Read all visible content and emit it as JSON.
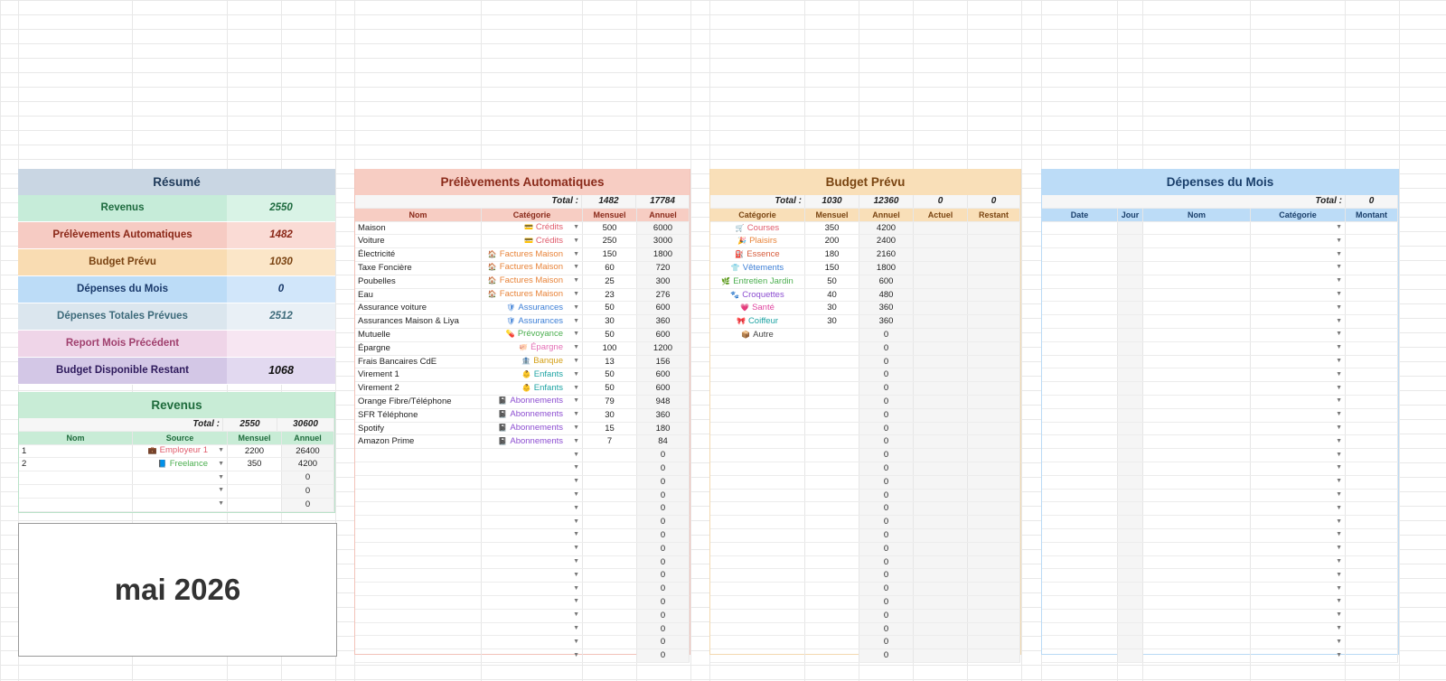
{
  "summary": {
    "title": "Résumé",
    "rows": [
      {
        "label": "Revenus",
        "value": "2550"
      },
      {
        "label": "Prélèvements Automatiques",
        "value": "1482"
      },
      {
        "label": "Budget Prévu",
        "value": "1030"
      },
      {
        "label": "Dépenses du Mois",
        "value": "0"
      },
      {
        "label": "Dépenses Totales Prévues",
        "value": "2512"
      },
      {
        "label": "Report Mois Précédent",
        "value": ""
      },
      {
        "label": "Budget Disponible Restant",
        "value": "1068"
      }
    ]
  },
  "revenus": {
    "title": "Revenus",
    "total_label": "Total :",
    "total_mensuel": "2550",
    "total_annuel": "30600",
    "headers": [
      "Nom",
      "Source",
      "Mensuel",
      "Annuel"
    ],
    "rows": [
      {
        "nom": "1",
        "source": "Employeur 1",
        "icon": "briefcase-icon",
        "mensuel": "2200",
        "annuel": "26400"
      },
      {
        "nom": "2",
        "source": "Freelance",
        "icon": "book-icon",
        "mensuel": "350",
        "annuel": "4200"
      },
      {
        "nom": "",
        "source": "",
        "icon": "",
        "mensuel": "",
        "annuel": "0"
      },
      {
        "nom": "",
        "source": "",
        "icon": "",
        "mensuel": "",
        "annuel": "0"
      },
      {
        "nom": "",
        "source": "",
        "icon": "",
        "mensuel": "",
        "annuel": "0"
      }
    ]
  },
  "month_label": "mai 2026",
  "prelevements": {
    "title": "Prélèvements Automatiques",
    "total_label": "Total :",
    "total_mensuel": "1482",
    "total_annuel": "17784",
    "headers": [
      "Nom",
      "Catégorie",
      "Mensuel",
      "Annuel"
    ],
    "rows": [
      {
        "nom": "Maison",
        "cat": "Crédits",
        "icon": "credit-card-icon",
        "mensuel": "500",
        "annuel": "6000"
      },
      {
        "nom": "Voiture",
        "cat": "Crédits",
        "icon": "credit-card-icon",
        "mensuel": "250",
        "annuel": "3000"
      },
      {
        "nom": "Électricité",
        "cat": "Factures Maison",
        "icon": "house-icon",
        "mensuel": "150",
        "annuel": "1800"
      },
      {
        "nom": "Taxe Foncière",
        "cat": "Factures Maison",
        "icon": "house-icon",
        "mensuel": "60",
        "annuel": "720"
      },
      {
        "nom": "Poubelles",
        "cat": "Factures Maison",
        "icon": "house-icon",
        "mensuel": "25",
        "annuel": "300"
      },
      {
        "nom": "Eau",
        "cat": "Factures Maison",
        "icon": "house-icon",
        "mensuel": "23",
        "annuel": "276"
      },
      {
        "nom": "Assurance voiture",
        "cat": "Assurances",
        "icon": "shield-icon",
        "mensuel": "50",
        "annuel": "600"
      },
      {
        "nom": "Assurances Maison & Liya",
        "cat": "Assurances",
        "icon": "shield-icon",
        "mensuel": "30",
        "annuel": "360"
      },
      {
        "nom": "Mutuelle",
        "cat": "Prévoyance",
        "icon": "pill-icon",
        "mensuel": "50",
        "annuel": "600"
      },
      {
        "nom": "Épargne",
        "cat": "Épargne",
        "icon": "piggy-bank-icon",
        "mensuel": "100",
        "annuel": "1200"
      },
      {
        "nom": "Frais Bancaires CdE",
        "cat": "Banque",
        "icon": "bank-icon",
        "mensuel": "13",
        "annuel": "156"
      },
      {
        "nom": "Virement 1",
        "cat": "Enfants",
        "icon": "baby-icon",
        "mensuel": "50",
        "annuel": "600"
      },
      {
        "nom": "Virement 2",
        "cat": "Enfants",
        "icon": "baby-icon",
        "mensuel": "50",
        "annuel": "600"
      },
      {
        "nom": "Orange Fibre/Téléphone",
        "cat": "Abonnements",
        "icon": "notebook-icon",
        "mensuel": "79",
        "annuel": "948"
      },
      {
        "nom": "SFR Téléphone",
        "cat": "Abonnements",
        "icon": "notebook-icon",
        "mensuel": "30",
        "annuel": "360"
      },
      {
        "nom": "Spotify",
        "cat": "Abonnements",
        "icon": "notebook-icon",
        "mensuel": "15",
        "annuel": "180"
      },
      {
        "nom": "Amazon Prime",
        "cat": "Abonnements",
        "icon": "notebook-icon",
        "mensuel": "7",
        "annuel": "84"
      }
    ],
    "empty_rows": 16,
    "empty_annuel": "0"
  },
  "budget": {
    "title": "Budget Prévu",
    "total_label": "Total :",
    "total_mensuel": "1030",
    "total_annuel": "12360",
    "total_actuel": "0",
    "total_restant": "0",
    "headers": [
      "Catégorie",
      "Mensuel",
      "Annuel",
      "Actuel",
      "Restant"
    ],
    "rows": [
      {
        "cat": "Courses",
        "icon": "cart-icon",
        "mensuel": "350",
        "annuel": "4200"
      },
      {
        "cat": "Plaisirs",
        "icon": "party-icon",
        "mensuel": "200",
        "annuel": "2400"
      },
      {
        "cat": "Essence",
        "icon": "fuel-icon",
        "mensuel": "180",
        "annuel": "2160"
      },
      {
        "cat": "Vêtements",
        "icon": "clothes-icon",
        "mensuel": "150",
        "annuel": "1800"
      },
      {
        "cat": "Entretien Jardin",
        "icon": "plant-icon",
        "mensuel": "50",
        "annuel": "600"
      },
      {
        "cat": "Croquettes",
        "icon": "paw-icon",
        "mensuel": "40",
        "annuel": "480"
      },
      {
        "cat": "Santé",
        "icon": "heart-icon",
        "mensuel": "30",
        "annuel": "360"
      },
      {
        "cat": "Coiffeur",
        "icon": "ribbon-icon",
        "mensuel": "30",
        "annuel": "360"
      },
      {
        "cat": "Autre",
        "icon": "box-icon",
        "mensuel": "",
        "annuel": "0"
      }
    ],
    "empty_rows": 24,
    "empty_annuel": "0"
  },
  "depenses": {
    "title": "Dépenses du Mois",
    "total_label": "Total :",
    "total_value": "0",
    "headers": [
      "Date",
      "Jour",
      "Nom",
      "Catégorie",
      "Montant"
    ],
    "empty_rows": 33
  },
  "colors": {
    "Crédits": "#e05c6c",
    "Factures Maison": "#e8843a",
    "Assurances": "#3d7fd6",
    "Prévoyance": "#4caf50",
    "Épargne": "#e46fb6",
    "Banque": "#d4a017",
    "Enfants": "#1ea3a3",
    "Abonnements": "#8d4fd1",
    "Courses": "#e05c6c",
    "Plaisirs": "#e8843a",
    "Essence": "#d65c3c",
    "Vêtements": "#3d7fd6",
    "Entretien Jardin": "#4caf50",
    "Croquettes": "#8d4fd1",
    "Santé": "#e046a0",
    "Coiffeur": "#1ea3a3",
    "Autre": "#444444",
    "Employeur 1": "#e05c6c",
    "Freelance": "#4caf50"
  },
  "icons": {
    "credit-card-icon": "💳",
    "house-icon": "🏠",
    "shield-icon": "🛡",
    "pill-icon": "💊",
    "piggy-bank-icon": "🐖",
    "bank-icon": "🏦",
    "baby-icon": "👶",
    "notebook-icon": "📓",
    "cart-icon": "🛒",
    "party-icon": "🎉",
    "fuel-icon": "⛽",
    "clothes-icon": "👕",
    "plant-icon": "🌿",
    "paw-icon": "🐾",
    "heart-icon": "💗",
    "ribbon-icon": "🎀",
    "box-icon": "📦",
    "briefcase-icon": "💼",
    "book-icon": "📘"
  }
}
